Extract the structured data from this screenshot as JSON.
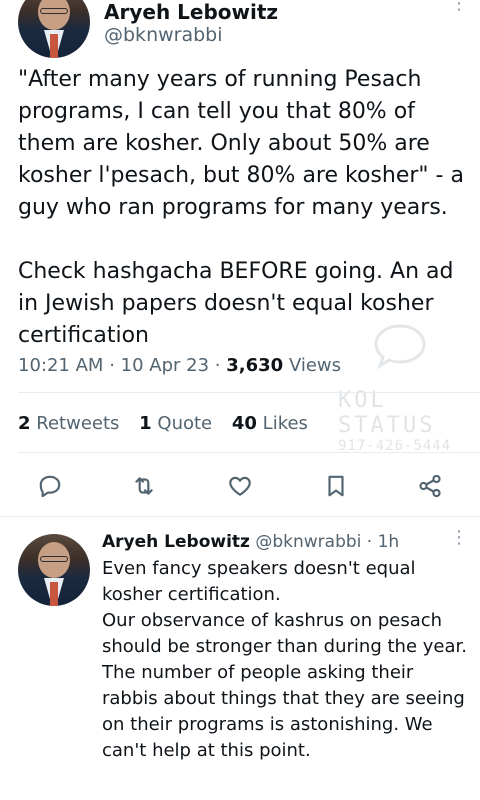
{
  "main_tweet": {
    "author_name": "Aryeh Lebowitz",
    "handle": "@bknwrabbi",
    "text": "\"After many years of running Pesach programs, I can tell you that 80% of them are kosher. Only about 50% are kosher l'pesach, but 80% are kosher\" - a guy who ran programs for many years.\n\nCheck hashgacha BEFORE going. An ad in Jewish papers doesn't equal kosher certification",
    "time": "10:21 AM",
    "date": "10 Apr 23",
    "views_count": "3,630",
    "views_label": "Views",
    "retweets_count": "2",
    "retweets_label": "Retweets",
    "quotes_count": "1",
    "quotes_label": "Quote",
    "likes_count": "40",
    "likes_label": "Likes"
  },
  "separator": "·",
  "actions": [
    "reply-icon",
    "retweet-icon",
    "like-icon",
    "bookmark-icon",
    "share-icon"
  ],
  "reply": {
    "author_name": "Aryeh Lebowitz",
    "handle": "@bknwrabbi",
    "time_ago": "1h",
    "text": "Even fancy speakers doesn't equal kosher certification.\nOur observance of kashrus on pesach should be stronger than during the year.\nThe number of people asking their rabbis about things that they are seeing on their programs is astonishing. We can't help at this point."
  },
  "watermark": {
    "title": "KOL STATUS",
    "phone": "917-426-5444"
  },
  "colors": {
    "text_primary": "#0f1419",
    "text_secondary": "#536471",
    "icon_gray": "#536471"
  }
}
